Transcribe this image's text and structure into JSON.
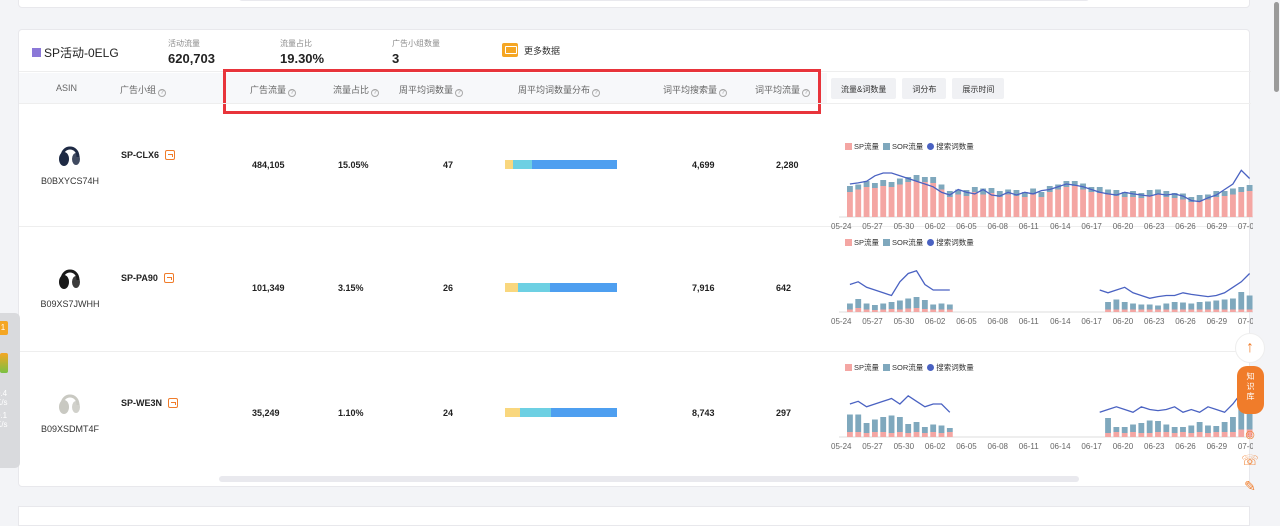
{
  "summary": {
    "campaign_name": "SP活动-0ELG",
    "metrics": [
      {
        "label": "活动流量",
        "value": "620,703"
      },
      {
        "label": "流量占比",
        "value": "19.30%"
      },
      {
        "label": "广告小组数量",
        "value": "3"
      }
    ],
    "more_data": "更多数据"
  },
  "table": {
    "headers": {
      "asin": "ASIN",
      "group": "广告小组",
      "ad_traffic": "广告流量",
      "traffic_share": "流量占比",
      "weekly_kw": "周平均词数量",
      "weekly_kw_dist": "周平均词数量分布",
      "avg_search": "词平均搜索量",
      "avg_traffic": "词平均流量"
    },
    "rows": [
      {
        "asin": "B0BXYCS74H",
        "group": "SP-CLX6",
        "ad_traffic": "484,105",
        "share": "15.05%",
        "kw": "47",
        "search": "4,699",
        "traffic": "2,280",
        "dist": [
          0.07,
          0.17,
          0.76
        ],
        "headphone_color": "#1e2a44"
      },
      {
        "asin": "B09XS7JWHH",
        "group": "SP-PA90",
        "ad_traffic": "101,349",
        "share": "3.15%",
        "kw": "26",
        "search": "7,916",
        "traffic": "642",
        "dist": [
          0.12,
          0.28,
          0.6
        ],
        "headphone_color": "#1a1a1a"
      },
      {
        "asin": "B09XSDMT4F",
        "group": "SP-WE3N",
        "ad_traffic": "35,249",
        "share": "1.10%",
        "kw": "24",
        "search": "8,743",
        "traffic": "297",
        "dist": [
          0.13,
          0.28,
          0.59
        ],
        "headphone_color": "#c9c9c2"
      }
    ]
  },
  "chart_tabs": [
    "流量&词数量",
    "词分布",
    "展示时间"
  ],
  "legend": {
    "sp": "SP流量",
    "sor": "SOR流量",
    "kw": "搜索词数量"
  },
  "colors": {
    "sp": "#f4a6a3",
    "sor": "#7fa8bd",
    "kw": "#4a62c2",
    "dist1": "#f9d77e",
    "dist2": "#6dd0e3",
    "dist3": "#4e9ff0",
    "accent": "#f07c2a",
    "highlight": "#e8343b"
  },
  "chart_dates": [
    "05-24",
    "05-27",
    "05-30",
    "06-02",
    "06-05",
    "06-08",
    "06-11",
    "06-14",
    "06-17",
    "06-20",
    "06-23",
    "06-26",
    "06-29",
    "07-0"
  ],
  "chart_data": [
    {
      "type": "bar",
      "name": "SP-CLX6 流量&词数量",
      "series": [
        {
          "name": "SP流量",
          "values": [
            0.5,
            0.55,
            0.6,
            0.58,
            0.62,
            0.6,
            0.65,
            0.7,
            0.72,
            0.7,
            0.68,
            0.55,
            0.4,
            0.45,
            0.42,
            0.5,
            0.45,
            0.48,
            0.4,
            0.45,
            0.42,
            0.4,
            0.45,
            0.4,
            0.5,
            0.55,
            0.6,
            0.62,
            0.55,
            0.5,
            0.48,
            0.45,
            0.42,
            0.4,
            0.4,
            0.38,
            0.42,
            0.45,
            0.4,
            0.38,
            0.35,
            0.3,
            0.32,
            0.35,
            0.4,
            0.42,
            0.45,
            0.5,
            0.52
          ]
        },
        {
          "name": "SOR流量",
          "values": [
            0.12,
            0.1,
            0.12,
            0.1,
            0.12,
            0.1,
            0.12,
            0.1,
            0.12,
            0.1,
            0.12,
            0.1,
            0.12,
            0.1,
            0.12,
            0.1,
            0.12,
            0.1,
            0.12,
            0.1,
            0.12,
            0.1,
            0.12,
            0.1,
            0.12,
            0.1,
            0.12,
            0.1,
            0.12,
            0.1,
            0.12,
            0.1,
            0.12,
            0.1,
            0.12,
            0.1,
            0.12,
            0.1,
            0.12,
            0.1,
            0.12,
            0.1,
            0.12,
            0.1,
            0.12,
            0.1,
            0.12,
            0.1,
            0.12
          ]
        },
        {
          "name": "搜索词数量",
          "values": [
            0.6,
            0.62,
            0.65,
            0.75,
            0.8,
            0.8,
            0.75,
            0.7,
            0.65,
            0.6,
            0.55,
            0.45,
            0.4,
            0.5,
            0.45,
            0.42,
            0.5,
            0.4,
            0.38,
            0.45,
            0.4,
            0.45,
            0.42,
            0.48,
            0.5,
            0.55,
            0.6,
            0.58,
            0.55,
            0.5,
            0.45,
            0.42,
            0.4,
            0.45,
            0.42,
            0.4,
            0.38,
            0.42,
            0.4,
            0.42,
            0.38,
            0.3,
            0.28,
            0.35,
            0.4,
            0.5,
            0.6,
            0.85,
            0.7
          ]
        }
      ]
    },
    {
      "type": "bar",
      "name": "SP-PA90 流量&词数量",
      "series": [
        {
          "name": "SP流量",
          "values": [
            0.05,
            0.08,
            0.05,
            0.04,
            0.05,
            0.06,
            0.05,
            0.07,
            0.08,
            0.06,
            0.05,
            0.05,
            0.05,
            null,
            null,
            null,
            null,
            null,
            null,
            null,
            null,
            null,
            null,
            null,
            null,
            null,
            null,
            null,
            null,
            null,
            null,
            0.05,
            0.05,
            0.05,
            0.05,
            0.05,
            0.05,
            0.05,
            0.05,
            0.05,
            0.05,
            0.05,
            0.05,
            0.05,
            0.05,
            0.05,
            0.05,
            0.05,
            0.05
          ]
        },
        {
          "name": "SOR流量",
          "values": [
            0.12,
            0.18,
            0.12,
            0.1,
            0.12,
            0.14,
            0.18,
            0.2,
            0.22,
            0.18,
            0.1,
            0.12,
            0.1,
            null,
            null,
            null,
            null,
            null,
            null,
            null,
            null,
            null,
            null,
            null,
            null,
            null,
            null,
            null,
            null,
            null,
            null,
            0.15,
            0.2,
            0.15,
            0.12,
            0.1,
            0.1,
            0.08,
            0.12,
            0.15,
            0.14,
            0.12,
            0.15,
            0.16,
            0.18,
            0.2,
            0.22,
            0.35,
            0.28
          ]
        },
        {
          "name": "搜索词数量",
          "values": [
            0.5,
            0.55,
            0.45,
            0.4,
            0.35,
            0.3,
            0.55,
            0.7,
            0.75,
            0.5,
            0.4,
            0.4,
            0.4,
            null,
            null,
            null,
            null,
            null,
            null,
            null,
            null,
            null,
            null,
            null,
            null,
            null,
            null,
            null,
            null,
            null,
            0.4,
            0.35,
            0.4,
            0.45,
            0.35,
            0.3,
            0.25,
            0.28,
            0.3,
            0.3,
            0.35,
            0.32,
            0.3,
            0.28,
            0.3,
            0.35,
            0.45,
            0.55,
            0.7
          ]
        }
      ]
    },
    {
      "type": "bar",
      "name": "SP-WE3N 流量&词数量",
      "series": [
        {
          "name": "SP流量",
          "values": [
            0.1,
            0.1,
            0.08,
            0.1,
            0.1,
            0.08,
            0.1,
            0.08,
            0.1,
            0.08,
            0.1,
            0.08,
            0.1,
            null,
            null,
            null,
            null,
            null,
            null,
            null,
            null,
            null,
            null,
            null,
            null,
            null,
            null,
            null,
            null,
            null,
            null,
            0.08,
            0.1,
            0.08,
            0.1,
            0.08,
            0.08,
            0.1,
            0.1,
            0.08,
            0.1,
            0.08,
            0.1,
            0.08,
            0.1,
            0.1,
            0.1,
            0.15,
            0.15
          ]
        },
        {
          "name": "SOR流量",
          "values": [
            0.35,
            0.35,
            0.2,
            0.25,
            0.3,
            0.35,
            0.3,
            0.18,
            0.2,
            0.12,
            0.15,
            0.15,
            0.08,
            null,
            null,
            null,
            null,
            null,
            null,
            null,
            null,
            null,
            null,
            null,
            null,
            null,
            null,
            null,
            null,
            null,
            null,
            0.3,
            0.1,
            0.12,
            0.15,
            0.2,
            0.25,
            0.22,
            0.15,
            0.12,
            0.1,
            0.15,
            0.2,
            0.15,
            0.12,
            0.2,
            0.3,
            0.45,
            0.55
          ]
        },
        {
          "name": "搜索词数量",
          "values": [
            0.6,
            0.65,
            0.55,
            0.6,
            0.65,
            0.7,
            0.6,
            0.75,
            0.65,
            0.55,
            0.6,
            0.6,
            0.45,
            null,
            null,
            null,
            null,
            null,
            null,
            null,
            null,
            null,
            null,
            null,
            null,
            null,
            null,
            null,
            null,
            null,
            0.45,
            0.5,
            0.55,
            0.5,
            0.45,
            0.55,
            0.5,
            0.48,
            0.5,
            0.55,
            0.45,
            0.5,
            0.45,
            0.55,
            0.5,
            0.45,
            0.6,
            0.8,
            0.75
          ]
        }
      ]
    }
  ]
}
